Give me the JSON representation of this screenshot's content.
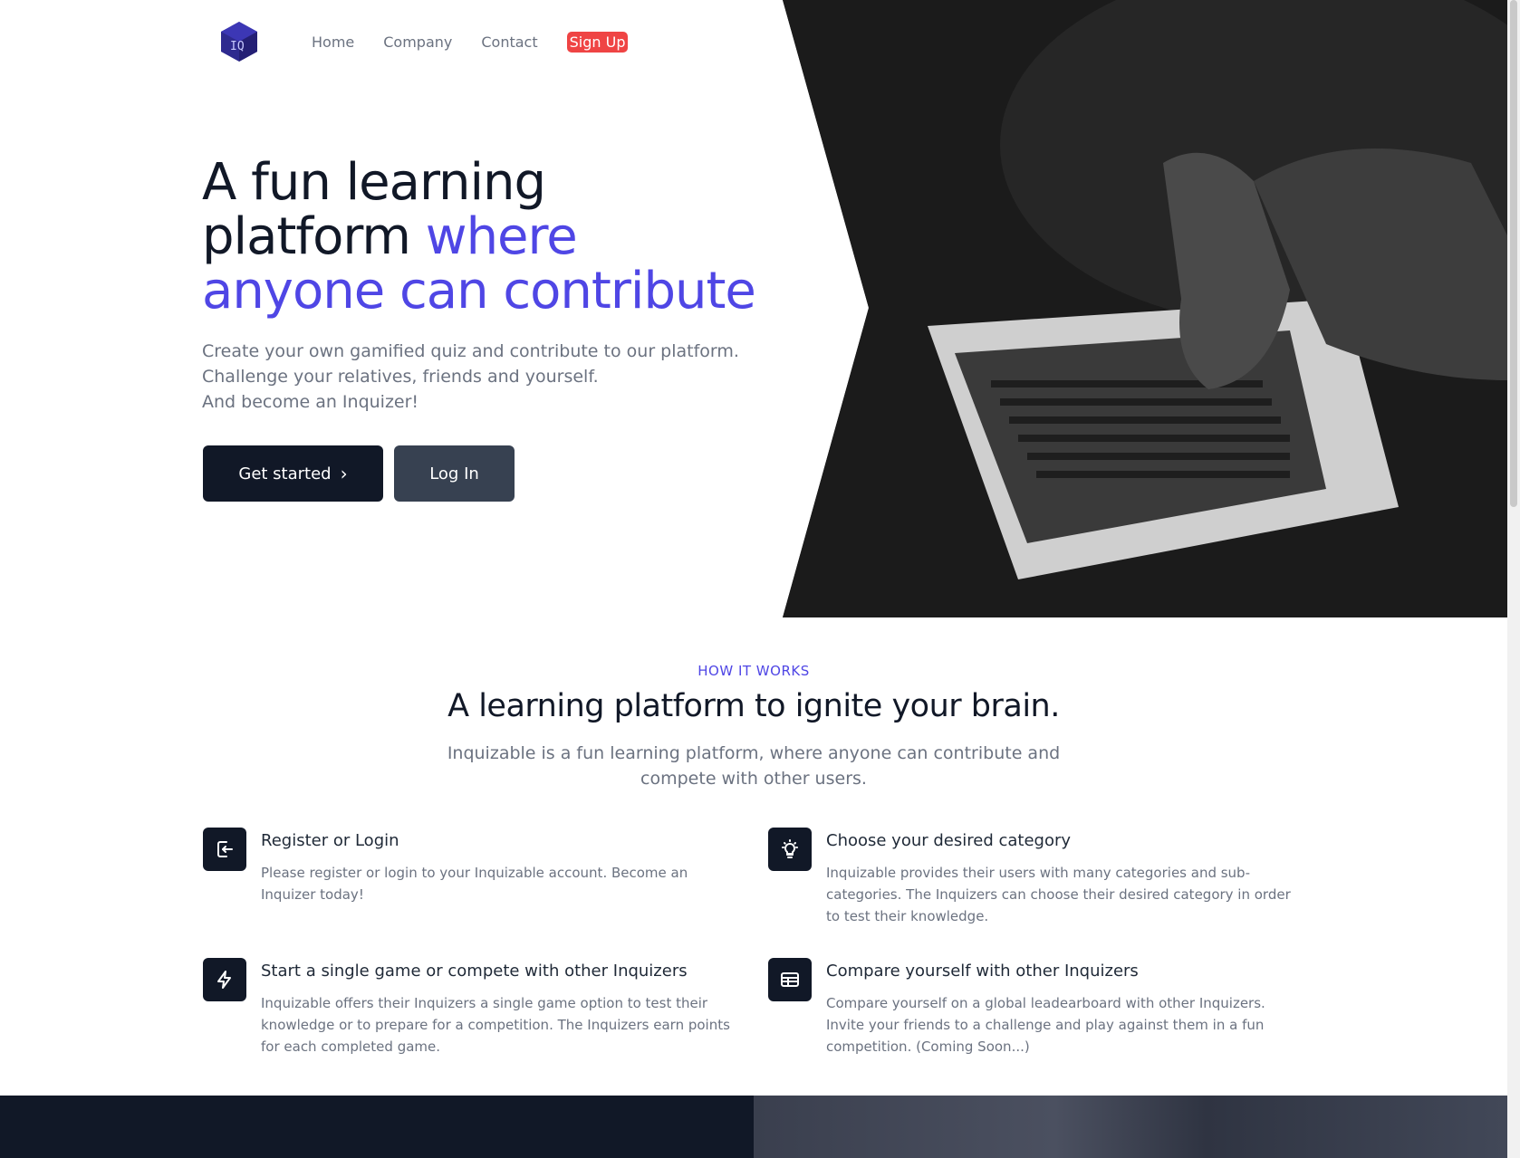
{
  "nav": {
    "logo_text": "IQ",
    "items": [
      "Home",
      "Company",
      "Contact"
    ],
    "signup_label": "Sign Up"
  },
  "hero": {
    "title_part1": "A fun learning platform",
    "title_part2": "where anyone can contribute",
    "subtitle_lines": [
      "Create your own gamified quiz and contribute to our platform.",
      "Challenge your relatives, friends and yourself.",
      "And become an Inquizer!"
    ],
    "get_started_label": "Get started",
    "login_label": "Log In"
  },
  "how": {
    "eyebrow": "HOW IT WORKS",
    "title": "A learning platform to ignite your brain.",
    "description": "Inquizable is a fun learning platform, where anyone can contribute and compete with other users.",
    "features": [
      {
        "icon": "login-icon",
        "title": "Register or Login",
        "description": "Please register or login to your Inquizable account. Become an Inquizer today!"
      },
      {
        "icon": "lightbulb-icon",
        "title": "Choose your desired category",
        "description": "Inquizable provides their users with many categories and sub-categories. The Inquizers can choose their desired category in order to test their knowledge."
      },
      {
        "icon": "lightning-icon",
        "title": "Start a single game or compete with other Inquizers",
        "description": "Inquizable offers their Inquizers a single game option to test their knowledge or to prepare for a competition. The Inquizers earn points for each completed game."
      },
      {
        "icon": "table-icon",
        "title": "Compare yourself with other Inquizers",
        "description": "Compare yourself on a global leadearboard with other Inquizers. Invite your friends to a challenge and play against them in a fun competition. (Coming Soon...)"
      }
    ]
  },
  "colors": {
    "accent": "#4f46e5",
    "dark": "#111827",
    "signup": "#ef4444",
    "secondary_button": "#374151"
  }
}
